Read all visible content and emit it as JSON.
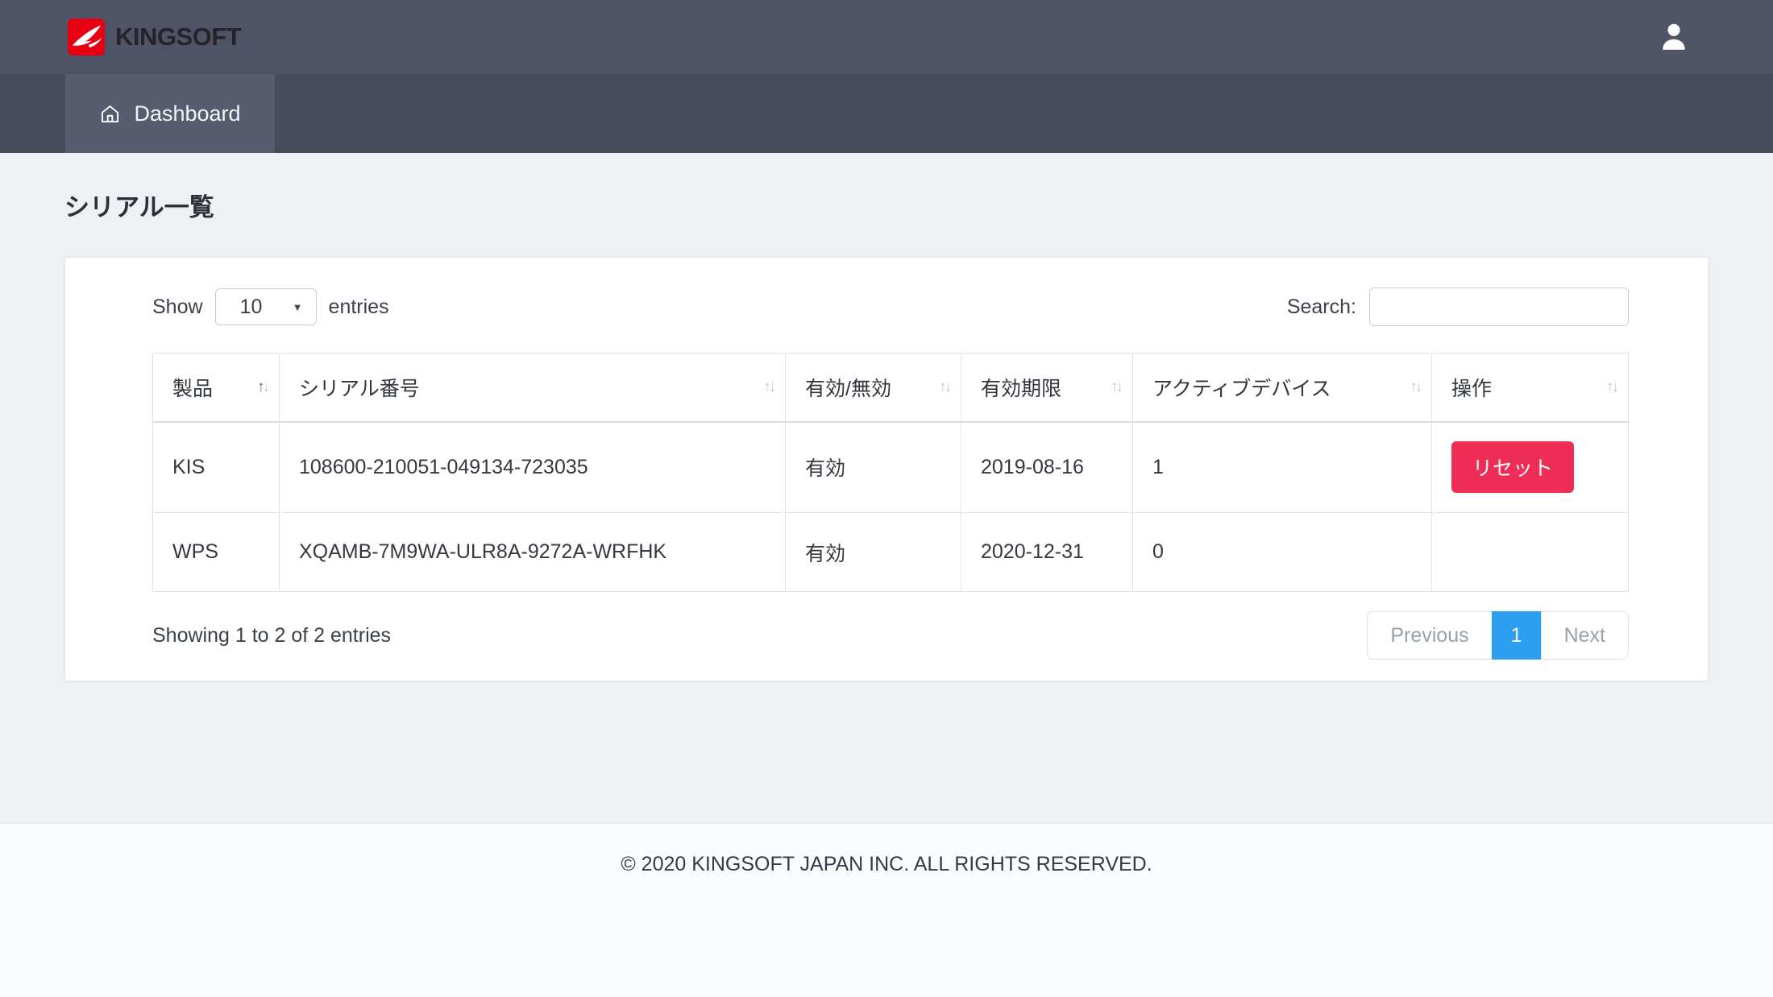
{
  "header": {
    "brand": "KINGSOFT"
  },
  "nav": {
    "items": [
      {
        "label": "Dashboard",
        "active": true
      }
    ]
  },
  "page": {
    "title": "シリアル一覧"
  },
  "controls": {
    "show_label": "Show",
    "page_length": "10",
    "entries_label": "entries",
    "search_label": "Search:",
    "search_value": ""
  },
  "table": {
    "columns": [
      "製品",
      "シリアル番号",
      "有効/無効",
      "有効期限",
      "アクティブデバイス",
      "操作"
    ],
    "rows": [
      {
        "product": "KIS",
        "serial": "108600-210051-049134-723035",
        "status": "有効",
        "expiry": "2019-08-16",
        "devices": "1",
        "action": "リセット"
      },
      {
        "product": "WPS",
        "serial": "XQAMB-7M9WA-ULR8A-9272A-WRFHK",
        "status": "有効",
        "expiry": "2020-12-31",
        "devices": "0",
        "action": ""
      }
    ]
  },
  "summary": {
    "info": "Showing 1 to 2 of 2 entries"
  },
  "pagination": {
    "previous": "Previous",
    "current": "1",
    "next": "Next"
  },
  "footer": {
    "copyright": "© 2020 KINGSOFT JAPAN INC. ALL RIGHTS RESERVED."
  },
  "icons": {
    "sort_asc": "↑",
    "sort_desc": "↓",
    "caret_down": "▼"
  },
  "colors": {
    "brand_red": "#e60012",
    "header_bg": "#4e5365",
    "nav_bg": "#464c5c",
    "active_tab_bg": "#575d6e",
    "reset_button": "#ee2e57",
    "active_page": "#2d9ff0",
    "body_bg": "#eef0f3"
  }
}
